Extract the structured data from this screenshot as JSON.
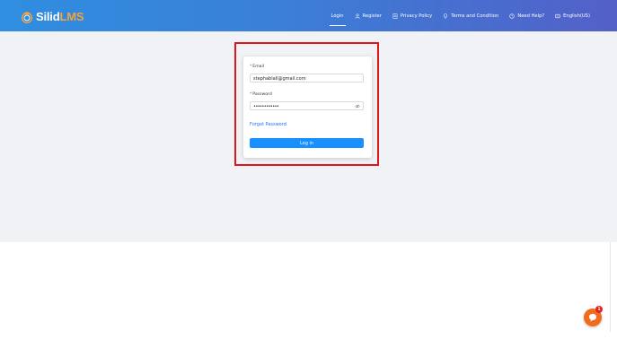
{
  "brand": {
    "name_part1": "Silid",
    "name_part2": "LMS",
    "logo_icon": "graduation-seal-icon"
  },
  "nav": {
    "login": "Login",
    "register": "Register",
    "privacy": "Privacy Policy",
    "terms": "Terms and Condition",
    "help": "Need Help?",
    "language": "English(US)"
  },
  "form": {
    "email_label": "Email",
    "email_value": "stephablall@gmail.com",
    "password_label": "Password",
    "password_value": "••••••••••••",
    "forgot": "Forgot Password",
    "login_button": "Log in"
  },
  "chat": {
    "badge": "1"
  },
  "colors": {
    "topbar_start": "#2f8ee0",
    "topbar_end": "#5360c8",
    "primary": "#1890ff",
    "highlight": "#e0161f",
    "brand_accent": "#f7a23a",
    "chat": "#f26b1d"
  }
}
